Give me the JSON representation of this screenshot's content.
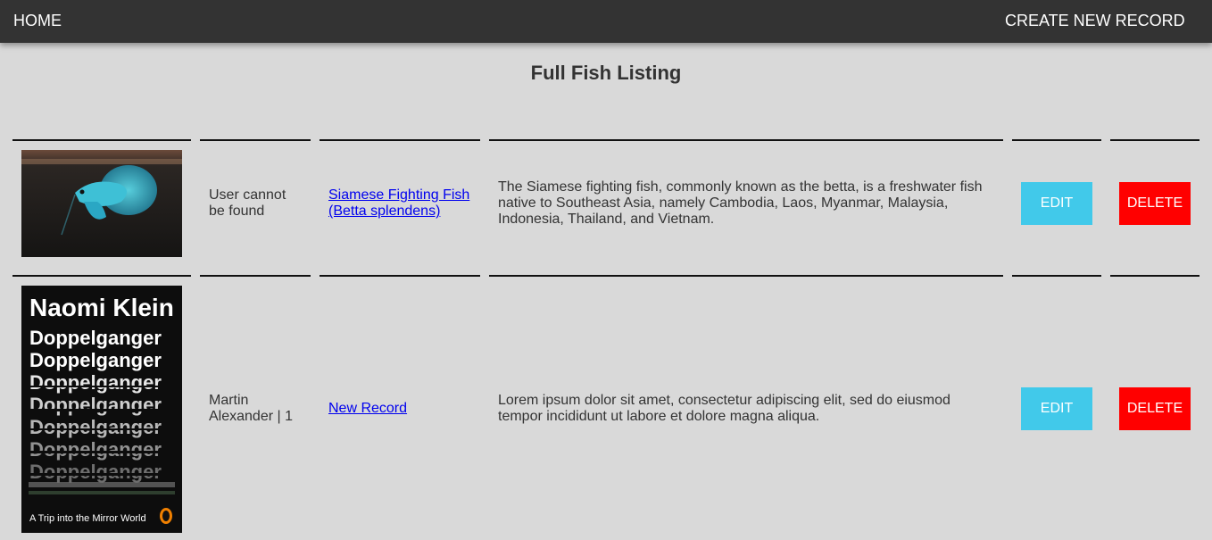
{
  "nav": {
    "home_label": "HOME",
    "create_label": "CREATE NEW RECORD"
  },
  "page": {
    "title": "Full Fish Listing"
  },
  "rows": [
    {
      "image_icon": "betta-fish-photo",
      "user_line1": "User cannot",
      "user_line2": "be found",
      "link_line1": "Siamese Fighting Fish",
      "link_line2": "(Betta splendens)",
      "desc_line1": "The Siamese fighting fish, commonly known as the betta, is a freshwater fish",
      "desc_line2": "native to Southeast Asia, namely Cambodia, Laos, Myanmar, Malaysia,",
      "desc_line3": "Indonesia, Thailand, and Vietnam.",
      "edit_label": "EDIT",
      "delete_label": "DELETE"
    },
    {
      "image_icon": "book-cover-image",
      "cover": {
        "author": "Naomi Klein",
        "title": "Doppelganger",
        "subtitle": "A Trip into the Mirror World"
      },
      "user_line1": "Martin",
      "user_line2": "Alexander | 1",
      "link_line1": "New Record",
      "desc_line1": "Lorem ipsum dolor sit amet, consectetur adipiscing elit, sed do eiusmod",
      "desc_line2": "tempor incididunt ut labore et dolore magna aliqua.",
      "edit_label": "EDIT",
      "delete_label": "DELETE"
    }
  ],
  "colors": {
    "topbar": "#333333",
    "background": "#d9d9d9",
    "edit_button": "#41c9ea",
    "delete_button": "#ff0000",
    "link": "#0000ee"
  }
}
